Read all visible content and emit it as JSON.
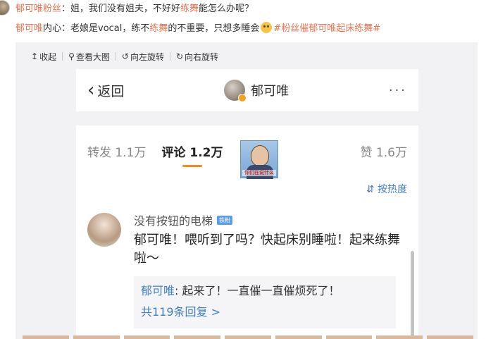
{
  "post": {
    "line1": {
      "author": "郁可唯粉丝",
      "text_a": "：姐，我们没有姐夫，不好好",
      "highlight": "练舞",
      "text_b": "能怎么办呢？"
    },
    "line2": {
      "author": "郁可唯",
      "text_a": "内心：老娘是vocal，练不",
      "highlight": "练舞",
      "text_b": "的不重要，只想多睡会",
      "tag": "#粉丝催郁可唯起床练舞#"
    }
  },
  "toolbar": {
    "collapse": "收起",
    "view_large": "查看大图",
    "rotate_left": "向左旋转",
    "rotate_right": "向右旋转"
  },
  "phone": {
    "back_label": "返回",
    "title": "郁可唯",
    "more": "···",
    "tabs": {
      "repost": "转发 1.1万",
      "comments": "评论 1.2万",
      "likes": "赞 1.6万"
    },
    "sticker_caption": "你们在说什么",
    "sort_label": "按热度",
    "comment": {
      "author": "没有按钮的电梯",
      "badge": "铁粉",
      "text": "郁可唯！喂听到了吗？快起床别睡啦！起来练舞啦～",
      "reply_author": "郁可唯",
      "reply_text": ": 起来了！一直催一直催烦死了！",
      "reply_more": "共119条回复 >"
    }
  },
  "colors": {
    "accent": "#eb7350",
    "link": "#3f7ec1",
    "tab_indicator": "#f28d1c"
  }
}
